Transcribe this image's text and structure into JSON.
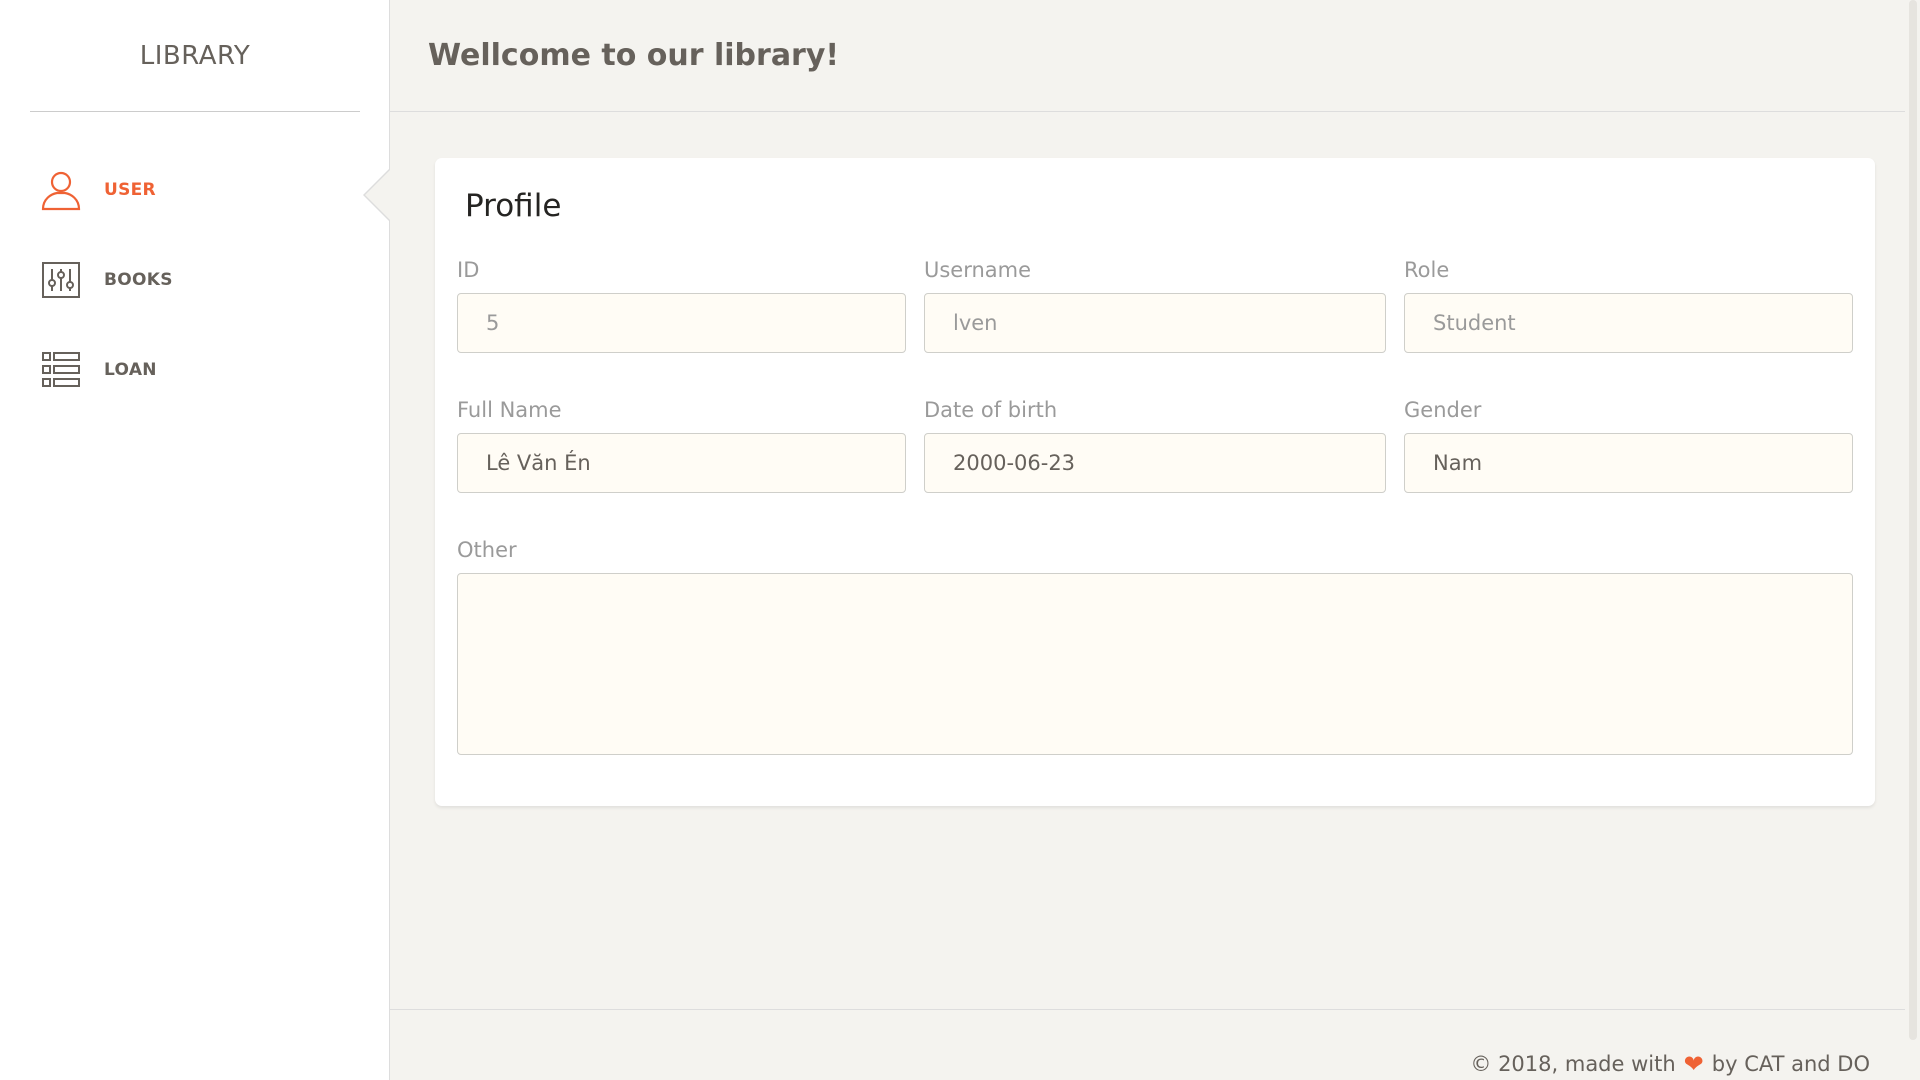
{
  "brand": {
    "title": "LIBRARY"
  },
  "header": {
    "title": "Wellcome to our library!"
  },
  "sidebar": {
    "active_color": "#ef6234",
    "items": [
      {
        "label": "USER",
        "icon": "user-icon",
        "active": true
      },
      {
        "label": "BOOKS",
        "icon": "sliders-icon",
        "active": false
      },
      {
        "label": "LOAN",
        "icon": "list-icon",
        "active": false
      }
    ]
  },
  "profile": {
    "title": "Profile",
    "fields": {
      "id": {
        "label": "ID",
        "value": "5"
      },
      "username": {
        "label": "Username",
        "value": "lven"
      },
      "role": {
        "label": "Role",
        "value": "Student"
      },
      "full_name": {
        "label": "Full Name",
        "value": "Lê Văn Én"
      },
      "dob": {
        "label": "Date of birth",
        "value": "2000-06-23"
      },
      "gender": {
        "label": "Gender",
        "value": "Nam"
      },
      "other": {
        "label": "Other",
        "value": ""
      }
    }
  },
  "footer": {
    "prefix": "© 2018, made with",
    "heart_icon": "heart-icon",
    "suffix": "by CAT and DO"
  }
}
